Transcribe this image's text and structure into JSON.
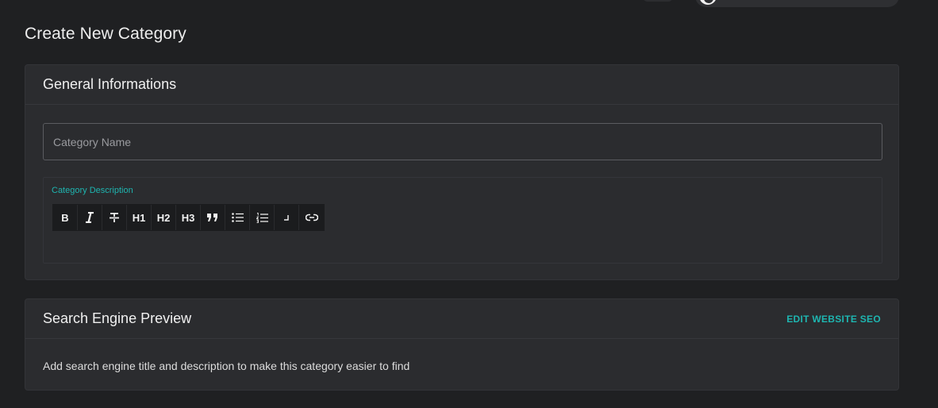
{
  "page": {
    "title": "Create New Category"
  },
  "general_card": {
    "title": "General Informations",
    "name_input": {
      "placeholder": "Category Name",
      "value": ""
    },
    "description_editor": {
      "label": "Category Description",
      "toolbar": [
        {
          "id": "bold",
          "icon": "bold-icon",
          "label": "B"
        },
        {
          "id": "italic",
          "icon": "italic-icon",
          "label": "I"
        },
        {
          "id": "strike",
          "icon": "strikethrough-icon",
          "label": ""
        },
        {
          "id": "h1",
          "icon": "heading-1-icon",
          "label": "H1"
        },
        {
          "id": "h2",
          "icon": "heading-2-icon",
          "label": "H2"
        },
        {
          "id": "h3",
          "icon": "heading-3-icon",
          "label": "H3"
        },
        {
          "id": "quote",
          "icon": "blockquote-icon",
          "label": ""
        },
        {
          "id": "bullet",
          "icon": "bullet-list-icon",
          "label": ""
        },
        {
          "id": "ordered",
          "icon": "ordered-list-icon",
          "label": ""
        },
        {
          "id": "break",
          "icon": "line-break-icon",
          "label": ""
        },
        {
          "id": "link",
          "icon": "link-icon",
          "label": ""
        }
      ],
      "content": ""
    }
  },
  "seo_card": {
    "title": "Search Engine Preview",
    "edit_link": "EDIT WEBSITE SEO",
    "body": "Add search engine title and description to make this category easier to find"
  },
  "colors": {
    "background": "#1f2022",
    "card": "#2b2c2f",
    "accent": "#1eb5b0"
  }
}
